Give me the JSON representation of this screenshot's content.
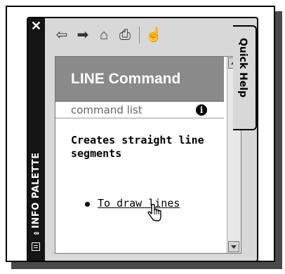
{
  "palette": {
    "title": "INFO PALETTE",
    "close_glyph": "✕"
  },
  "toolbar": {
    "icons": [
      "back-arrow-icon",
      "forward-arrow-icon",
      "home-icon",
      "print-icon",
      "lock-hand-icon"
    ]
  },
  "side_tab": {
    "label": "Quick Help"
  },
  "help": {
    "title": "LINE Command",
    "subhead": "command list",
    "description": "Creates straight line segments",
    "link": "To draw lines"
  },
  "colors": {
    "header_bg": "#8a8a8a",
    "titlebar_bg": "#141414"
  }
}
